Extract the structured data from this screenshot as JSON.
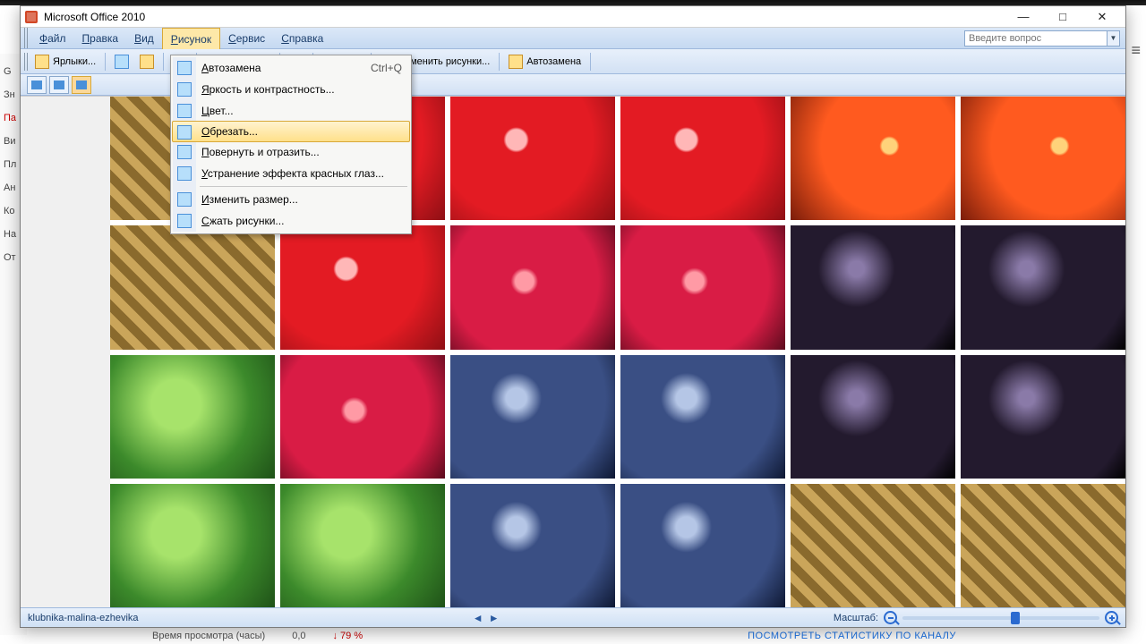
{
  "background": {
    "sidebar": [
      "G",
      "Зн",
      "Па",
      "Ви",
      "Пл",
      "Ан",
      "Ко",
      "На",
      "От"
    ],
    "sidebar_red_index": 2,
    "bottom_label": "Время просмотра (часы)",
    "bottom_value": "0,0",
    "bottom_delta": "↓ 79 %",
    "bottom_stats": "ПОСМОТРЕТЬ СТАТИСТИКУ ПО КАНАЛУ",
    "hamburger": "≡"
  },
  "window": {
    "title": "Microsoft Office 2010",
    "controls": {
      "min": "—",
      "max": "□",
      "close": "✕"
    }
  },
  "menubar": {
    "items": [
      "Файл",
      "Правка",
      "Вид",
      "Рисунок",
      "Сервис",
      "Справка"
    ],
    "open_index": 3,
    "question_placeholder": "Введите вопрос"
  },
  "toolbar": {
    "shortcuts_label": "Ярлыки...",
    "edit_pics_label": "Изменить рисунки...",
    "autoreplace_label": "Автозамена"
  },
  "dropdown": {
    "items": [
      {
        "label": "Автозамена",
        "shortcut": "Ctrl+Q"
      },
      {
        "label": "Яркость и контрастность..."
      },
      {
        "label": "Цвет..."
      },
      {
        "label": "Обрезать..."
      },
      {
        "label": "Повернуть и отразить..."
      },
      {
        "label": "Устранение эффекта красных глаз..."
      },
      {
        "sep": true
      },
      {
        "label": "Изменить размер..."
      },
      {
        "label": "Сжать рисунки..."
      }
    ],
    "hover_index": 3
  },
  "statusbar": {
    "filename": "klubnika-malina-ezhevika",
    "nav_prev": "◄",
    "nav_next": "►",
    "zoom_label": "Масштаб:"
  },
  "image": {
    "rows": 4,
    "cols": 6,
    "tiles": [
      "mat",
      "strawberry",
      "strawberry",
      "strawberry",
      "strawberry2",
      "strawberry2",
      "mat",
      "strawberry",
      "raspberry",
      "raspberry",
      "black",
      "black",
      "leaf",
      "raspberry",
      "blue",
      "blue",
      "black",
      "black",
      "leaf",
      "leaf",
      "blue",
      "blue",
      "mat",
      "mat"
    ]
  }
}
